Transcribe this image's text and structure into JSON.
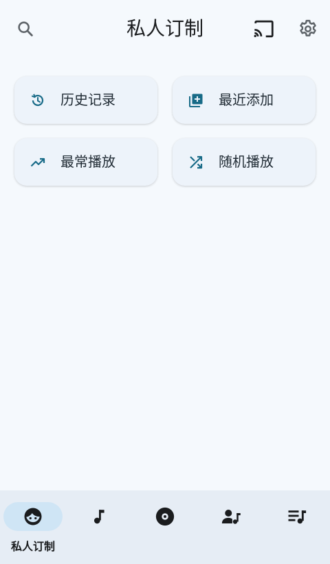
{
  "header": {
    "title": "私人订制",
    "search_icon": "search-icon",
    "cast_icon": "cast-icon",
    "settings_icon": "gear-icon"
  },
  "shortcuts": [
    {
      "label": "历史记录",
      "icon": "history-icon"
    },
    {
      "label": "最近添加",
      "icon": "library-add-icon"
    },
    {
      "label": "最常播放",
      "icon": "trending-up-icon"
    },
    {
      "label": "随机播放",
      "icon": "shuffle-icon"
    }
  ],
  "bottom_nav": {
    "items": [
      {
        "label": "私人订制",
        "icon": "face-icon",
        "active": true
      },
      {
        "label": "",
        "icon": "music-note-icon"
      },
      {
        "label": "",
        "icon": "album-icon"
      },
      {
        "label": "",
        "icon": "artist-icon"
      },
      {
        "label": "",
        "icon": "playlist-icon"
      }
    ]
  },
  "colors": {
    "background": "#f5f9fd",
    "card": "#edf3fa",
    "accent_icon": "#176a87",
    "nav_background": "#e6edf5",
    "nav_active_pill": "#cfe5f5"
  }
}
